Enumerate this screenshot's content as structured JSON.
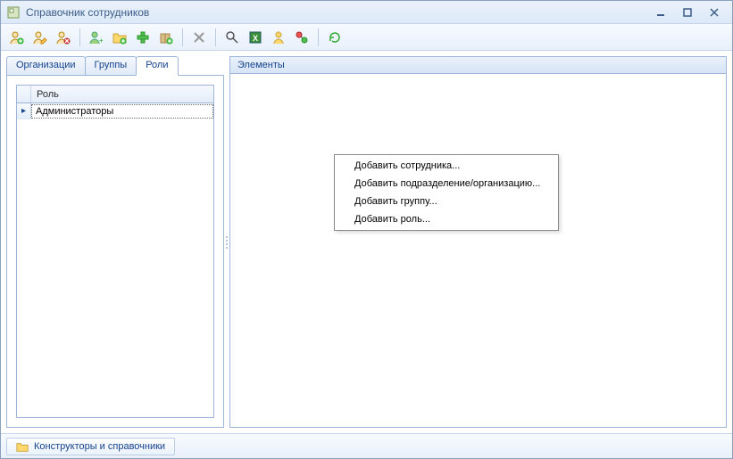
{
  "window": {
    "title": "Справочник сотрудников"
  },
  "toolbar": {
    "icons": [
      "user-add-icon",
      "user-edit-icon",
      "user-delete-icon",
      "sep",
      "person-green-add-icon",
      "folder-add-icon",
      "plus-icon",
      "package-add-icon",
      "sep",
      "delete-cross-icon",
      "sep",
      "search-icon",
      "excel-export-icon",
      "status-icon",
      "toggle-icon",
      "sep",
      "refresh-icon"
    ]
  },
  "tabs": {
    "org": "Организации",
    "groups": "Группы",
    "roles": "Роли",
    "active_index": 2
  },
  "grid": {
    "column_header": "Роль",
    "rows": [
      {
        "label": "Администраторы",
        "selected": true
      }
    ]
  },
  "right_panel": {
    "title": "Элементы"
  },
  "context_menu": {
    "items": [
      "Добавить сотрудника...",
      "Добавить подразделение/организацию...",
      "Добавить группу...",
      "Добавить роль..."
    ]
  },
  "statusbar": {
    "button_label": "Конструкторы и справочники"
  }
}
